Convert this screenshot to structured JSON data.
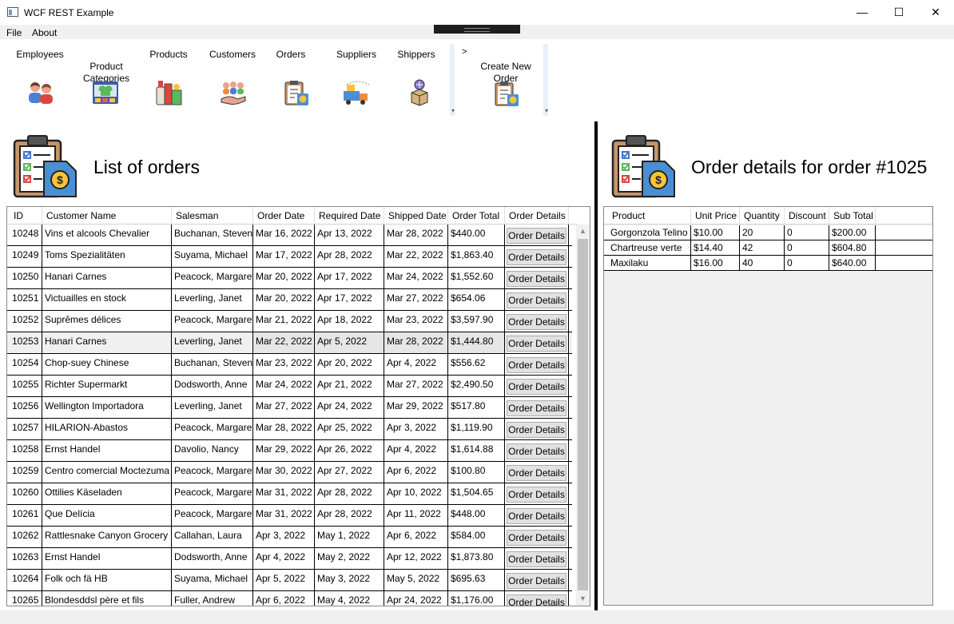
{
  "window": {
    "title": "WCF REST Example",
    "minimize": "—",
    "maximize": "☐",
    "close": "✕"
  },
  "menu": [
    {
      "label": "File"
    },
    {
      "label": "About"
    }
  ],
  "ribbon": {
    "items": [
      {
        "label": "Employees",
        "icon": "employees-icon"
      },
      {
        "label": "Product\nCategories",
        "icon": "categories-icon"
      },
      {
        "label": "Products",
        "icon": "products-icon"
      },
      {
        "label": "Customers",
        "icon": "customers-icon"
      },
      {
        "label": "Orders",
        "icon": "orders-icon"
      },
      {
        "label": "Suppliers",
        "icon": "suppliers-icon"
      },
      {
        "label": "Shippers",
        "icon": "shippers-icon"
      }
    ],
    "arrow": ">",
    "create": {
      "label": "Create New\nOrder",
      "icon": "create-order-icon"
    },
    "scroll_glyph": "▾"
  },
  "orders_panel": {
    "heading": "List of orders",
    "columns": [
      "ID",
      "Customer Name",
      "Salesman",
      "Order Date",
      "Required Date",
      "Shipped Date",
      "Order Total",
      "Order Details"
    ],
    "button_label": "Order Details",
    "rows": [
      [
        "10248",
        "Vins et alcools Chevalier",
        "Buchanan, Steven",
        "Mar 16, 2022",
        "Apr 13, 2022",
        "Mar 28, 2022",
        "$440.00"
      ],
      [
        "10249",
        "Toms Spezialitäten",
        "Suyama, Michael",
        "Mar 17, 2022",
        "Apr 28, 2022",
        "Mar 22, 2022",
        "$1,863.40"
      ],
      [
        "10250",
        "Hanari Carnes",
        "Peacock, Margaret",
        "Mar 20, 2022",
        "Apr 17, 2022",
        "Mar 24, 2022",
        "$1,552.60"
      ],
      [
        "10251",
        "Victuailles en stock",
        "Leverling, Janet",
        "Mar 20, 2022",
        "Apr 17, 2022",
        "Mar 27, 2022",
        "$654.06"
      ],
      [
        "10252",
        "Suprêmes délices",
        "Peacock, Margaret",
        "Mar 21, 2022",
        "Apr 18, 2022",
        "Mar 23, 2022",
        "$3,597.90"
      ],
      [
        "10253",
        "Hanari Carnes",
        "Leverling, Janet",
        "Mar 22, 2022",
        "Apr 5, 2022",
        "Mar 28, 2022",
        "$1,444.80"
      ],
      [
        "10254",
        "Chop-suey Chinese",
        "Buchanan, Steven",
        "Mar 23, 2022",
        "Apr 20, 2022",
        "Apr 4, 2022",
        "$556.62"
      ],
      [
        "10255",
        "Richter Supermarkt",
        "Dodsworth, Anne",
        "Mar 24, 2022",
        "Apr 21, 2022",
        "Mar 27, 2022",
        "$2,490.50"
      ],
      [
        "10256",
        "Wellington Importadora",
        "Leverling, Janet",
        "Mar 27, 2022",
        "Apr 24, 2022",
        "Mar 29, 2022",
        "$517.80"
      ],
      [
        "10257",
        "HILARION-Abastos",
        "Peacock, Margaret",
        "Mar 28, 2022",
        "Apr 25, 2022",
        "Apr 3, 2022",
        "$1,119.90"
      ],
      [
        "10258",
        "Ernst Handel",
        "Davolio, Nancy",
        "Mar 29, 2022",
        "Apr 26, 2022",
        "Apr 4, 2022",
        "$1,614.88"
      ],
      [
        "10259",
        "Centro comercial Moctezuma",
        "Peacock, Margaret",
        "Mar 30, 2022",
        "Apr 27, 2022",
        "Apr 6, 2022",
        "$100.80"
      ],
      [
        "10260",
        "Ottilies Käseladen",
        "Peacock, Margaret",
        "Mar 31, 2022",
        "Apr 28, 2022",
        "Apr 10, 2022",
        "$1,504.65"
      ],
      [
        "10261",
        "Que Delícia",
        "Peacock, Margaret",
        "Mar 31, 2022",
        "Apr 28, 2022",
        "Apr 11, 2022",
        "$448.00"
      ],
      [
        "10262",
        "Rattlesnake Canyon Grocery",
        "Callahan, Laura",
        "Apr 3, 2022",
        "May 1, 2022",
        "Apr 6, 2022",
        "$584.00"
      ],
      [
        "10263",
        "Ernst Handel",
        "Dodsworth, Anne",
        "Apr 4, 2022",
        "May 2, 2022",
        "Apr 12, 2022",
        "$1,873.80"
      ],
      [
        "10264",
        "Folk och fä HB",
        "Suyama, Michael",
        "Apr 5, 2022",
        "May 3, 2022",
        "May 5, 2022",
        "$695.63"
      ],
      [
        "10265",
        "Blondesddsl père et fils",
        "Fuller, Andrew",
        "Apr 6, 2022",
        "May 4, 2022",
        "Apr 24, 2022",
        "$1,176.00"
      ]
    ],
    "selected_row": 5,
    "scroll_up": "▲",
    "scroll_down": "▼"
  },
  "details_panel": {
    "heading": "Order details for order #1025",
    "columns": [
      "Product",
      "Unit Price",
      "Quantity",
      "Discount",
      "Sub Total"
    ],
    "rows": [
      [
        "Gorgonzola Telino",
        "$10.00",
        "20",
        "0",
        "$200.00"
      ],
      [
        "Chartreuse verte",
        "$14.40",
        "42",
        "0",
        "$604.80"
      ],
      [
        "Maxilaku",
        "$16.00",
        "40",
        "0",
        "$640.00"
      ]
    ]
  },
  "colors": {
    "accent_blue": "#3c78c8",
    "clipboard_brown": "#c8956a",
    "money_yellow": "#f5c43c"
  }
}
